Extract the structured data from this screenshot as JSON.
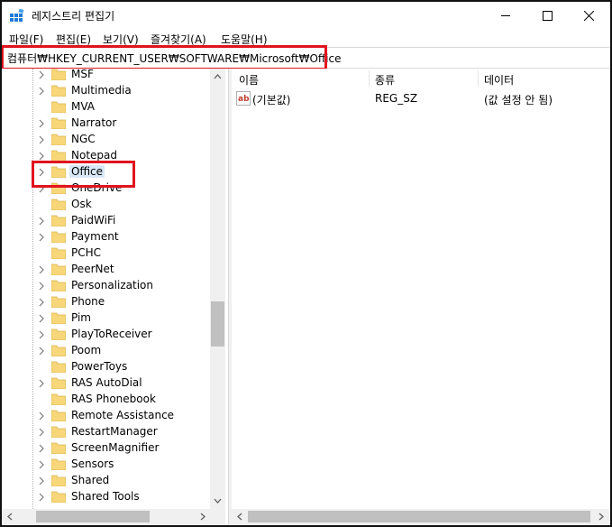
{
  "window": {
    "title": "레지스트리 편집기",
    "icon": "registry-editor-icon",
    "controls": {
      "minimize": "minimize-icon",
      "maximize": "maximize-icon",
      "close": "close-icon"
    }
  },
  "menu": [
    "파일(F)",
    "편집(E)",
    "보기(V)",
    "즐겨찾기(A)",
    "도움말(H)"
  ],
  "address": {
    "path": "컴퓨터₩HKEY_CURRENT_USER₩SOFTWARE₩Microsoft₩Office"
  },
  "tree": {
    "items": [
      "MSF",
      "Multimedia",
      "MVA",
      "Narrator",
      "NGC",
      "Notepad",
      "Office",
      "OneDrive",
      "Osk",
      "PaidWiFi",
      "Payment",
      "PCHC",
      "PeerNet",
      "Personalization",
      "Phone",
      "Pim",
      "PlayToReceiver",
      "Poom",
      "PowerToys",
      "RAS AutoDial",
      "RAS Phonebook",
      "Remote Assistance",
      "RestartManager",
      "ScreenMagnifier",
      "Sensors",
      "Shared",
      "Shared Tools"
    ],
    "selected": "Office"
  },
  "list": {
    "columns": [
      "이름",
      "종류",
      "데이터"
    ],
    "rows": [
      {
        "name": "(기본값)",
        "type": "REG_SZ",
        "data": "(값 설정 안 됨)"
      }
    ]
  },
  "colors": {
    "highlight": "#e0141e",
    "selection": "#d9e8f7",
    "folder": "#f7d77a"
  }
}
